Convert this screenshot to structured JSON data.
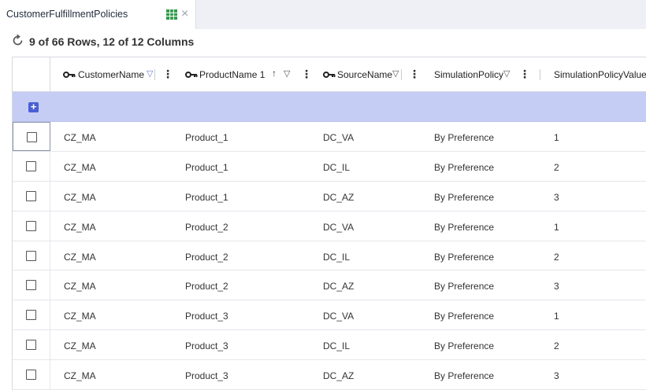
{
  "tab": {
    "title": "CustomerFulfillmentPolicies",
    "close": "×"
  },
  "status": {
    "row_count": "9 of 66 Rows, 12 of 12 Columns"
  },
  "columns": [
    {
      "label": "CustomerName",
      "key": true,
      "sort": "",
      "filter": true
    },
    {
      "label": "ProductName 1",
      "key": true,
      "sort": "↑",
      "filter": true
    },
    {
      "label": "SourceName",
      "key": true,
      "sort": "",
      "filter": true
    },
    {
      "label": "SimulationPolicy",
      "key": false,
      "sort": "",
      "filter": true
    },
    {
      "label": "SimulationPolicyValue",
      "key": false,
      "sort": "",
      "filter": false
    }
  ],
  "add_row_label": "+",
  "rows": [
    [
      "CZ_MA",
      "Product_1",
      "DC_VA",
      "By Preference",
      "1"
    ],
    [
      "CZ_MA",
      "Product_1",
      "DC_IL",
      "By Preference",
      "2"
    ],
    [
      "CZ_MA",
      "Product_1",
      "DC_AZ",
      "By Preference",
      "3"
    ],
    [
      "CZ_MA",
      "Product_2",
      "DC_VA",
      "By Preference",
      "1"
    ],
    [
      "CZ_MA",
      "Product_2",
      "DC_IL",
      "By Preference",
      "2"
    ],
    [
      "CZ_MA",
      "Product_2",
      "DC_AZ",
      "By Preference",
      "3"
    ],
    [
      "CZ_MA",
      "Product_3",
      "DC_VA",
      "By Preference",
      "1"
    ],
    [
      "CZ_MA",
      "Product_3",
      "DC_IL",
      "By Preference",
      "2"
    ],
    [
      "CZ_MA",
      "Product_3",
      "DC_AZ",
      "By Preference",
      "3"
    ]
  ],
  "colors": {
    "accent": "#4a5fd6",
    "add_row_bg": "#c5cdf4",
    "filter_icon": "#6a7bd0",
    "sheet_icon": "#2e9b48"
  }
}
